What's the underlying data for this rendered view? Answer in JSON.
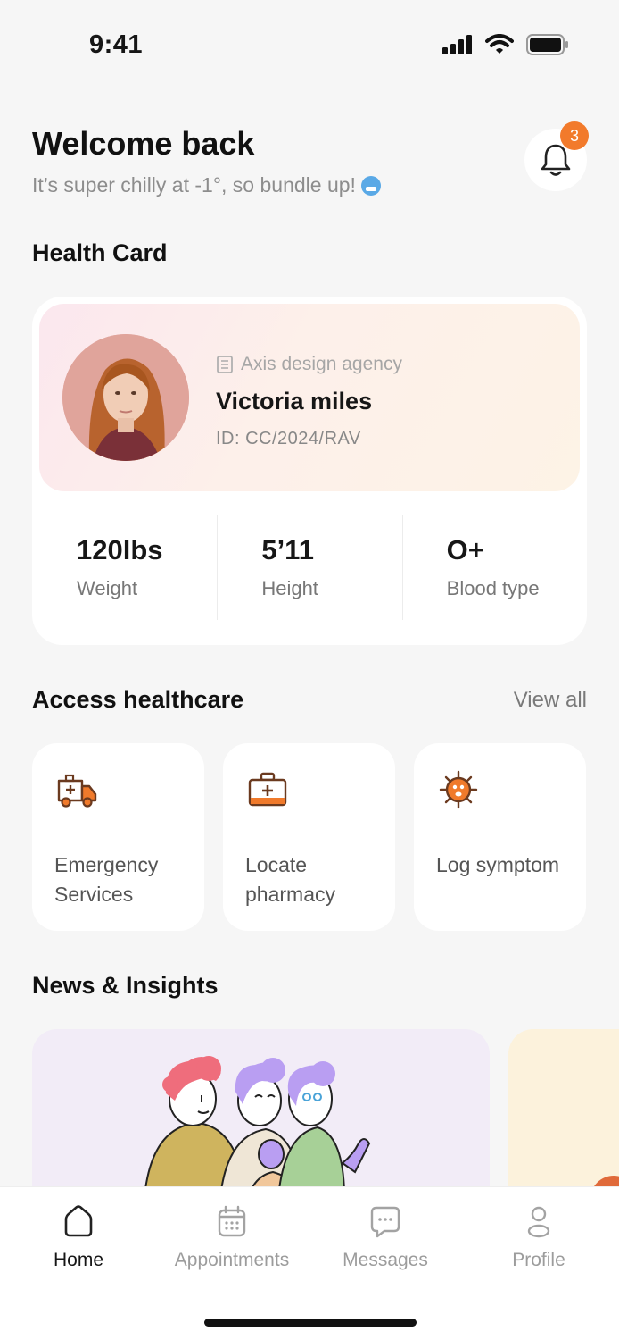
{
  "status_bar": {
    "time": "9:41"
  },
  "header": {
    "title": "Welcome back",
    "subtitle": "It’s super chilly at -1°, so bundle up!",
    "notification_count": "3"
  },
  "health_card": {
    "section_title": "Health Card",
    "organization": "Axis design agency",
    "name": "Victoria miles",
    "member_id": "ID: CC/2024/RAV",
    "stats": [
      {
        "value": "120lbs",
        "label": "Weight"
      },
      {
        "value": "5’11",
        "label": "Height"
      },
      {
        "value": "O+",
        "label": "Blood type"
      }
    ]
  },
  "access": {
    "section_title": "Access healthcare",
    "view_all": "View all",
    "tiles": [
      {
        "label": "Emergency Services",
        "icon": "ambulance-icon"
      },
      {
        "label": "Locate pharmacy",
        "icon": "first-aid-kit-icon"
      },
      {
        "label": "Log symptom",
        "icon": "virus-icon"
      }
    ]
  },
  "news": {
    "section_title": "News & Insights"
  },
  "tabbar": {
    "tabs": [
      {
        "label": "Home",
        "icon": "home-icon",
        "active": true
      },
      {
        "label": "Appointments",
        "icon": "calendar-icon",
        "active": false
      },
      {
        "label": "Messages",
        "icon": "chat-icon",
        "active": false
      },
      {
        "label": "Profile",
        "icon": "person-icon",
        "active": false
      }
    ]
  },
  "colors": {
    "accent": "#f27a2b",
    "icon_brown": "#6b3a1f",
    "background": "#f6f6f6"
  }
}
